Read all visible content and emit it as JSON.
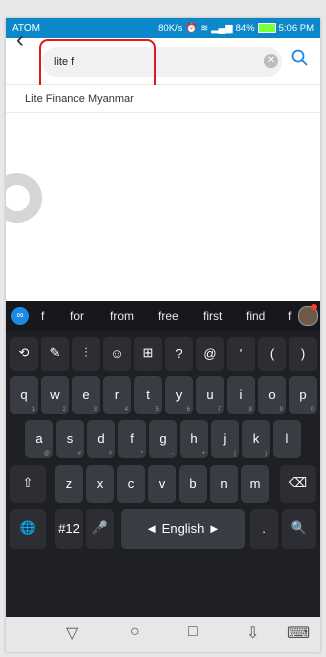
{
  "status_bar": {
    "carrier": "ATOM",
    "speed": "80K/s",
    "battery": "84%",
    "time": "5:06 PM",
    "icons": [
      "alarm-icon",
      "wifi-icon",
      "signal-icon",
      "battery-icon"
    ],
    "bg_color": "#0a88c9"
  },
  "search": {
    "query": "lite f",
    "back_icon": "back-arrow-icon",
    "clear_icon": "clear-icon",
    "search_icon": "search-icon",
    "accent": "#1e88e5"
  },
  "suggestions": [
    "Lite Finance Myanmar"
  ],
  "keyboard": {
    "predictions": [
      "f",
      "for",
      "from",
      "free",
      "first",
      "find",
      "f"
    ],
    "tool_row": [
      "⟲",
      "✎",
      "⫶",
      "☺",
      "⊞",
      "?",
      "@",
      "'",
      "(",
      ")"
    ],
    "row1": [
      {
        "k": "q",
        "h": "1"
      },
      {
        "k": "w",
        "h": "2"
      },
      {
        "k": "e",
        "h": "3"
      },
      {
        "k": "r",
        "h": "4"
      },
      {
        "k": "t",
        "h": "5"
      },
      {
        "k": "y",
        "h": "6"
      },
      {
        "k": "u",
        "h": "7"
      },
      {
        "k": "i",
        "h": "8"
      },
      {
        "k": "o",
        "h": "9"
      },
      {
        "k": "p",
        "h": "0"
      }
    ],
    "row2": [
      {
        "k": "a",
        "h": "@"
      },
      {
        "k": "s",
        "h": "#"
      },
      {
        "k": "d",
        "h": "₫"
      },
      {
        "k": "f",
        "h": "*"
      },
      {
        "k": "g",
        "h": "-"
      },
      {
        "k": "h",
        "h": "+"
      },
      {
        "k": "j",
        "h": "("
      },
      {
        "k": "k",
        "h": ")"
      },
      {
        "k": "l",
        "h": ""
      }
    ],
    "row3": [
      {
        "k": "z",
        "h": ""
      },
      {
        "k": "x",
        "h": ""
      },
      {
        "k": "c",
        "h": ""
      },
      {
        "k": "v",
        "h": ""
      },
      {
        "k": "b",
        "h": ""
      },
      {
        "k": "n",
        "h": ""
      },
      {
        "k": "m",
        "h": ""
      }
    ],
    "shift_label": "⇧",
    "backspace_label": "⌫",
    "globe_label": "🌐",
    "numbers_label": "#12",
    "mic_label": "🎤",
    "space_label": "◄ English ►",
    "period_label": ".",
    "search_key_label": "🔍"
  },
  "navbar": {
    "back": "▽",
    "home": "○",
    "recents": "□",
    "hide_keyboard": "⇩",
    "keyboard_switch": "⌨"
  }
}
